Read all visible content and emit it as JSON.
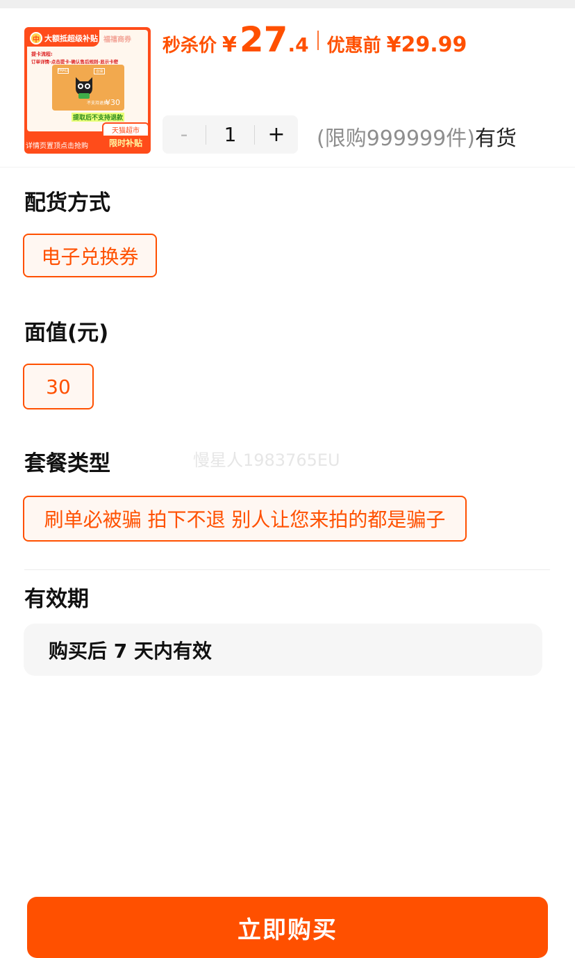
{
  "product": {
    "image": {
      "banner": "大额抵超级补贴",
      "coin_symbol": "中",
      "brand": "福禧商券",
      "flow_title": "提卡流程:",
      "flow_steps": "订单详情-点击提卡-确认售后规则-显示卡密",
      "card_logo": "TMALL",
      "card_tag": "合油",
      "card_no_refund": "不支持退换",
      "card_value": "¥30",
      "warning": "提取后不支持退款",
      "footer": "详情页置顶点击抢购",
      "badge_top": "天猫超市",
      "badge_bottom": "限时补贴"
    },
    "flash_price_label": "秒杀价",
    "flash_price_symbol": "¥",
    "flash_price_integer": "27",
    "flash_price_decimal": ".4",
    "original_price_label": "优惠前",
    "original_price": "¥29.99",
    "accent_color": "#ff5000"
  },
  "quantity": {
    "minus_label": "-",
    "value": "1",
    "plus_label": "+",
    "limit_text": "(限购999999件)",
    "stock_status": "有货"
  },
  "sections": {
    "delivery": {
      "title": "配货方式",
      "option": "电子兑换券"
    },
    "face_value": {
      "title": "面值(元)",
      "option": "30"
    },
    "package": {
      "title": "套餐类型",
      "option": "刷单必被骗 拍下不退 别人让您来拍的都是骗子"
    },
    "validity": {
      "title": "有效期",
      "text": "购买后 7 天内有效"
    }
  },
  "watermark": "慢星人1983765EU",
  "buy_button_label": "立即购买"
}
